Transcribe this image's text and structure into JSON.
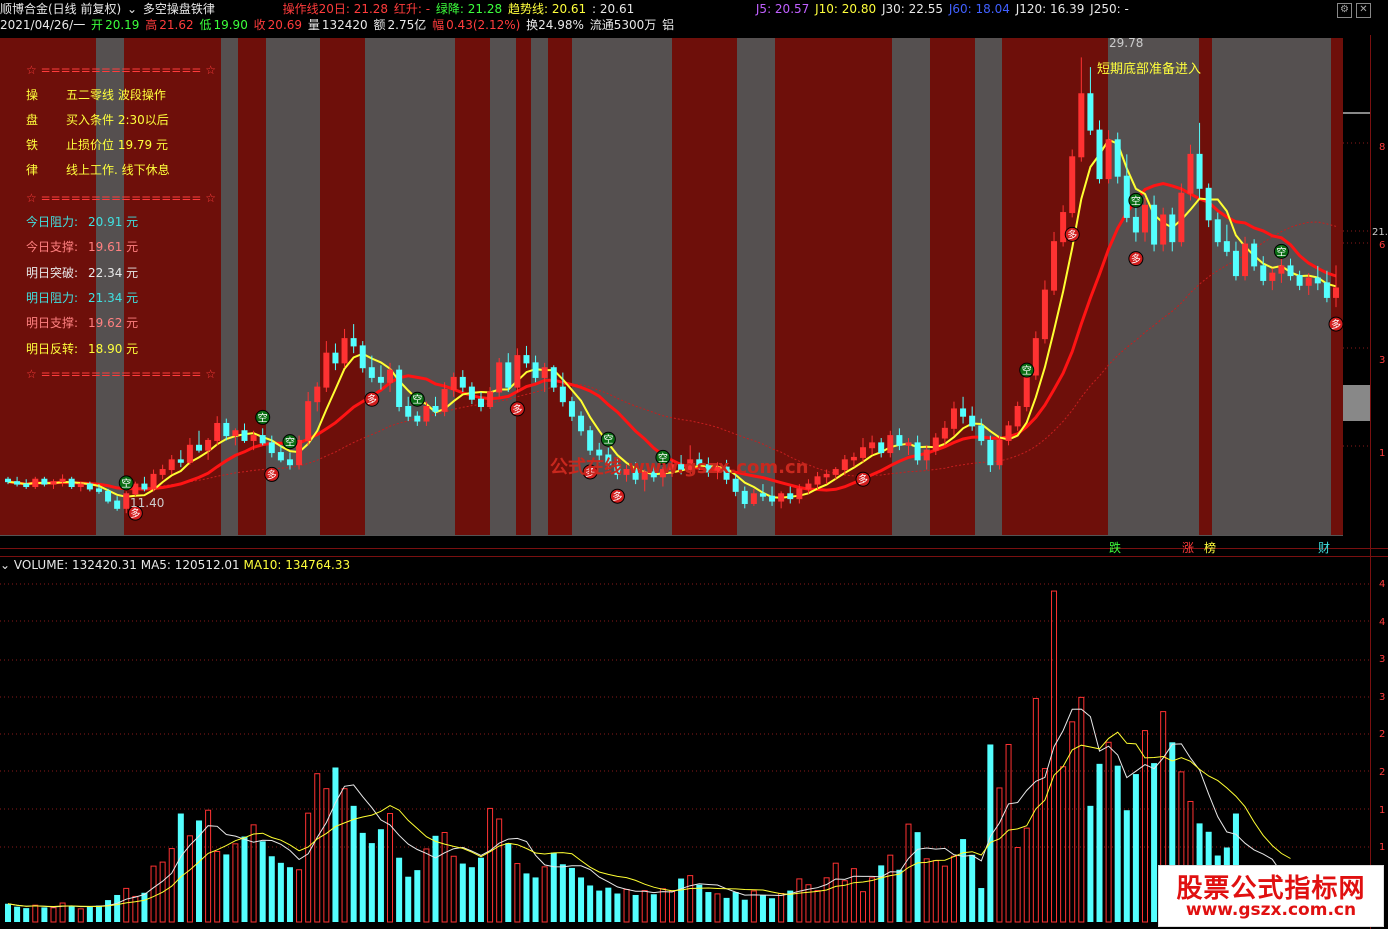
{
  "header": {
    "stock_name": "顺博合金(日线 前复权)",
    "indicator_name": "多空操盘铁律",
    "date": "2021/04/26/一",
    "open_label": "开",
    "open": "20.19",
    "high_label": "高",
    "high": "21.62",
    "low_label": "低",
    "low": "19.90",
    "close_label": "收",
    "close": "20.69",
    "vol_label": "量",
    "vol": "132420",
    "amount_label": "额",
    "amount": "2.75亿",
    "change_label": "幅",
    "change": "0.43(2.12%)",
    "turnover": "换24.98%",
    "float": "流通5300万",
    "sector": "铝",
    "line20": "操作线20日: 21.28",
    "red_up": "红升: -",
    "green_down": "绿降: 21.28",
    "trend": "趋势线: 20.61",
    "trend2": ": 20.61",
    "j5": "J5: 20.57",
    "j10": "J10: 20.80",
    "j30": "J30: 22.55",
    "j60": "J60: 18.04",
    "j120": "J120: 16.39",
    "j250": "J250: -"
  },
  "info_panel": {
    "separator": "☆ ================ ☆",
    "rows": [
      {
        "k": "操",
        "v": "五二零线 波段操作"
      },
      {
        "k": "盘",
        "v": "买入条件  2:30以后"
      },
      {
        "k": "铁",
        "v": "止损价位  19.79 元"
      },
      {
        "k": "律",
        "v": "线上工作. 线下休息"
      }
    ],
    "levels": [
      {
        "label": "今日阻力:",
        "value": "20.91 元",
        "color": "#40e0e0"
      },
      {
        "label": "今日支撑:",
        "value": "19.61 元",
        "color": "#ff8080"
      },
      {
        "label": "明日突破:",
        "value": "22.34 元",
        "color": "#e8e8e8"
      },
      {
        "label": "明日阻力:",
        "value": "21.34 元",
        "color": "#40e0e0"
      },
      {
        "label": "明日支撑:",
        "value": "19.62 元",
        "color": "#ff8080"
      },
      {
        "label": "明日反转:",
        "value": "18.90 元",
        "color": "#ffff3c"
      }
    ]
  },
  "annotations": {
    "peak_label": "29.78",
    "low_label": "11.40",
    "signal_text": "短期底部准备进入",
    "empty_marker": "空",
    "long_marker": "多",
    "bottom_marks": [
      "跌",
      "涨",
      "榜",
      "财"
    ],
    "right_axis_marks": [
      "8",
      "21.",
      "6",
      "3",
      "1"
    ],
    "watermark_mid": "公式在线  www.gszx.com.cn",
    "watermark_corner_1": "股票公式指标网",
    "watermark_corner_2": "www.gszx.com.cn"
  },
  "volume_header": {
    "volume": "VOLUME: 132420.31",
    "ma5": "MA5: 120512.01",
    "ma10": "MA10: 134764.33"
  },
  "vol_axis_marks": [
    "4",
    "4",
    "3",
    "3",
    "2",
    "2",
    "1",
    "1"
  ],
  "colors": {
    "up": "#ff3232",
    "down": "#54ffff",
    "bg_red": "#6e0f0a",
    "bg_gray": "#555050",
    "ma_yellow": "#ffff32",
    "ma_red": "#ff1414"
  },
  "chart_data": {
    "type": "candlestick",
    "ylim": [
      10.5,
      31
    ],
    "candles": [
      [
        12.8,
        12.9,
        12.6,
        12.7
      ],
      [
        12.7,
        12.9,
        12.5,
        12.6
      ],
      [
        12.6,
        12.8,
        12.4,
        12.5
      ],
      [
        12.5,
        12.9,
        12.4,
        12.8
      ],
      [
        12.8,
        12.9,
        12.5,
        12.6
      ],
      [
        12.6,
        12.8,
        12.4,
        12.7
      ],
      [
        12.7,
        13.0,
        12.5,
        12.8
      ],
      [
        12.8,
        12.9,
        12.4,
        12.5
      ],
      [
        12.5,
        12.7,
        12.3,
        12.6
      ],
      [
        12.6,
        12.7,
        12.3,
        12.4
      ],
      [
        12.4,
        12.6,
        12.2,
        12.3
      ],
      [
        12.3,
        12.4,
        11.8,
        11.9
      ],
      [
        11.9,
        12.1,
        11.5,
        11.6
      ],
      [
        11.6,
        12.3,
        11.4,
        12.2
      ],
      [
        12.2,
        12.7,
        12.1,
        12.6
      ],
      [
        12.6,
        12.9,
        12.3,
        12.4
      ],
      [
        12.4,
        13.2,
        12.3,
        13.0
      ],
      [
        13.0,
        13.4,
        12.8,
        13.2
      ],
      [
        13.2,
        13.8,
        13.0,
        13.6
      ],
      [
        13.6,
        14.0,
        13.3,
        13.5
      ],
      [
        13.5,
        14.5,
        13.4,
        14.2
      ],
      [
        14.2,
        14.8,
        13.9,
        14.0
      ],
      [
        14.0,
        14.5,
        13.6,
        14.4
      ],
      [
        14.4,
        15.4,
        14.2,
        15.1
      ],
      [
        15.1,
        15.3,
        14.4,
        14.6
      ],
      [
        14.6,
        14.9,
        14.2,
        14.8
      ],
      [
        14.8,
        15.1,
        14.3,
        14.4
      ],
      [
        14.4,
        14.8,
        14.0,
        14.6
      ],
      [
        14.6,
        14.9,
        14.2,
        14.3
      ],
      [
        14.3,
        14.6,
        13.7,
        13.9
      ],
      [
        13.9,
        14.2,
        13.5,
        13.6
      ],
      [
        13.6,
        13.9,
        13.2,
        13.4
      ],
      [
        13.4,
        14.6,
        13.2,
        14.4
      ],
      [
        14.4,
        16.4,
        14.2,
        16.0
      ],
      [
        16.0,
        16.8,
        15.6,
        16.6
      ],
      [
        16.6,
        18.5,
        16.4,
        18.0
      ],
      [
        18.0,
        18.4,
        17.3,
        17.6
      ],
      [
        17.6,
        19.0,
        17.4,
        18.6
      ],
      [
        18.6,
        19.2,
        18.0,
        18.3
      ],
      [
        18.3,
        18.5,
        17.2,
        17.4
      ],
      [
        17.4,
        17.9,
        16.8,
        17.0
      ],
      [
        17.0,
        17.5,
        16.5,
        16.8
      ],
      [
        16.8,
        17.6,
        16.4,
        17.3
      ],
      [
        17.3,
        17.5,
        15.6,
        15.8
      ],
      [
        15.8,
        16.2,
        15.2,
        15.4
      ],
      [
        15.4,
        15.6,
        15.0,
        15.2
      ],
      [
        15.2,
        16.0,
        15.0,
        15.8
      ],
      [
        15.8,
        16.2,
        15.4,
        15.6
      ],
      [
        15.6,
        16.8,
        15.4,
        16.5
      ],
      [
        16.5,
        17.2,
        16.2,
        17.0
      ],
      [
        17.0,
        17.3,
        16.4,
        16.6
      ],
      [
        16.6,
        16.8,
        15.9,
        16.1
      ],
      [
        16.1,
        16.4,
        15.6,
        15.8
      ],
      [
        15.8,
        16.6,
        15.7,
        16.4
      ],
      [
        16.4,
        17.8,
        16.2,
        17.6
      ],
      [
        17.6,
        18.0,
        16.4,
        16.6
      ],
      [
        16.6,
        18.2,
        16.4,
        17.9
      ],
      [
        17.9,
        18.3,
        17.4,
        17.6
      ],
      [
        17.6,
        17.9,
        16.8,
        17.0
      ],
      [
        17.0,
        17.6,
        16.4,
        17.4
      ],
      [
        17.4,
        17.5,
        16.4,
        16.6
      ],
      [
        16.6,
        17.2,
        15.8,
        16.0
      ],
      [
        16.0,
        16.2,
        15.2,
        15.4
      ],
      [
        15.4,
        15.6,
        14.6,
        14.8
      ],
      [
        14.8,
        15.0,
        13.8,
        14.0
      ],
      [
        14.0,
        14.3,
        13.5,
        13.8
      ],
      [
        13.8,
        14.1,
        13.2,
        13.4
      ],
      [
        13.4,
        13.7,
        12.8,
        13.0
      ],
      [
        13.0,
        13.4,
        12.7,
        13.2
      ],
      [
        13.2,
        13.5,
        12.6,
        12.8
      ],
      [
        12.8,
        13.2,
        12.3,
        13.1
      ],
      [
        13.1,
        13.4,
        12.7,
        12.9
      ],
      [
        12.9,
        13.3,
        12.5,
        13.2
      ],
      [
        13.2,
        13.6,
        12.9,
        13.4
      ],
      [
        13.4,
        13.8,
        13.0,
        13.2
      ],
      [
        13.2,
        14.2,
        13.0,
        13.6
      ],
      [
        13.6,
        13.9,
        13.2,
        13.4
      ],
      [
        13.4,
        13.7,
        12.9,
        13.1
      ],
      [
        13.1,
        13.5,
        12.8,
        13.3
      ],
      [
        13.3,
        13.6,
        12.6,
        12.8
      ],
      [
        12.8,
        13.0,
        12.1,
        12.3
      ],
      [
        12.3,
        12.5,
        11.6,
        11.8
      ],
      [
        11.8,
        12.4,
        11.7,
        12.2
      ],
      [
        12.2,
        12.6,
        11.9,
        12.1
      ],
      [
        12.1,
        12.5,
        11.7,
        11.9
      ],
      [
        11.9,
        12.3,
        11.6,
        12.2
      ],
      [
        12.2,
        12.5,
        11.8,
        12.0
      ],
      [
        12.0,
        12.6,
        11.8,
        12.4
      ],
      [
        12.4,
        12.8,
        12.2,
        12.6
      ],
      [
        12.6,
        13.1,
        12.4,
        12.9
      ],
      [
        12.9,
        13.2,
        12.6,
        13.0
      ],
      [
        13.0,
        13.3,
        12.8,
        13.2
      ],
      [
        13.2,
        13.8,
        13.0,
        13.6
      ],
      [
        13.6,
        13.9,
        13.3,
        13.7
      ],
      [
        13.7,
        14.5,
        13.5,
        14.1
      ],
      [
        14.1,
        14.6,
        13.8,
        14.3
      ],
      [
        14.3,
        14.5,
        13.7,
        13.9
      ],
      [
        13.9,
        14.8,
        13.7,
        14.6
      ],
      [
        14.6,
        14.9,
        14.0,
        14.2
      ],
      [
        14.2,
        14.5,
        13.8,
        14.3
      ],
      [
        14.3,
        14.6,
        13.4,
        13.6
      ],
      [
        13.6,
        14.2,
        13.2,
        14.0
      ],
      [
        14.0,
        14.7,
        13.8,
        14.5
      ],
      [
        14.5,
        15.2,
        14.2,
        14.9
      ],
      [
        14.9,
        16.0,
        14.6,
        15.7
      ],
      [
        15.7,
        16.2,
        15.1,
        15.4
      ],
      [
        15.4,
        15.8,
        14.8,
        15.0
      ],
      [
        15.0,
        15.3,
        14.2,
        14.4
      ],
      [
        14.4,
        14.6,
        13.1,
        13.4
      ],
      [
        13.4,
        14.6,
        13.2,
        14.4
      ],
      [
        14.4,
        15.2,
        14.2,
        15.0
      ],
      [
        15.0,
        16.0,
        14.8,
        15.8
      ],
      [
        15.8,
        17.4,
        15.6,
        17.1
      ],
      [
        17.1,
        18.9,
        16.9,
        18.6
      ],
      [
        18.6,
        21.0,
        18.4,
        20.6
      ],
      [
        20.6,
        23.0,
        20.4,
        22.6
      ],
      [
        22.6,
        24.1,
        22.4,
        23.8
      ],
      [
        23.8,
        26.4,
        23.6,
        26.1
      ],
      [
        26.1,
        30.2,
        25.9,
        28.7
      ],
      [
        28.7,
        29.8,
        27.0,
        27.2
      ],
      [
        27.2,
        27.6,
        25.0,
        25.2
      ],
      [
        25.2,
        27.2,
        25.0,
        26.8
      ],
      [
        26.8,
        27.1,
        25.0,
        25.3
      ],
      [
        25.3,
        26.2,
        23.4,
        23.6
      ],
      [
        23.6,
        24.4,
        22.6,
        23.0
      ],
      [
        23.0,
        24.4,
        22.6,
        24.1
      ],
      [
        24.1,
        24.5,
        22.2,
        22.5
      ],
      [
        22.5,
        24.0,
        22.2,
        23.7
      ],
      [
        23.7,
        24.0,
        22.2,
        22.6
      ],
      [
        22.6,
        25.0,
        22.4,
        24.6
      ],
      [
        24.6,
        26.6,
        24.3,
        26.2
      ],
      [
        26.2,
        27.5,
        24.4,
        24.8
      ],
      [
        24.8,
        25.0,
        23.2,
        23.5
      ],
      [
        23.5,
        23.8,
        22.4,
        22.6
      ],
      [
        22.6,
        23.3,
        22.0,
        22.2
      ],
      [
        22.2,
        22.6,
        21.0,
        21.2
      ],
      [
        21.2,
        22.8,
        21.0,
        22.5
      ],
      [
        22.5,
        22.7,
        21.4,
        21.6
      ],
      [
        21.6,
        22.0,
        20.8,
        21.0
      ],
      [
        21.0,
        21.5,
        20.6,
        21.3
      ],
      [
        21.3,
        21.9,
        20.9,
        21.6
      ],
      [
        21.6,
        21.9,
        21.0,
        21.2
      ],
      [
        21.2,
        21.4,
        20.6,
        20.8
      ],
      [
        20.8,
        21.3,
        20.4,
        21.1
      ],
      [
        21.1,
        21.6,
        20.6,
        20.9
      ],
      [
        20.9,
        21.4,
        20.1,
        20.3
      ],
      [
        20.3,
        21.62,
        19.9,
        20.69
      ]
    ],
    "volumes": [
      5,
      4.2,
      3.8,
      4.6,
      4.0,
      3.9,
      5.2,
      4.4,
      3.6,
      4.1,
      4.5,
      6.0,
      7.4,
      9.2,
      7.0,
      8.0,
      15.3,
      16.4,
      20.1,
      29.7,
      23.6,
      27.8,
      30.6,
      19.3,
      18.5,
      21.4,
      23.4,
      26.6,
      22.1,
      18.0,
      16.2,
      15.0,
      14.3,
      29.8,
      40.6,
      36.5,
      42.3,
      36.5,
      31.8,
      24.4,
      21.6,
      25.4,
      29.7,
      17.6,
      12.4,
      14.2,
      20.0,
      23.6,
      24.5,
      18.0,
      16.0,
      15.0,
      17.6,
      31.1,
      28.2,
      21.6,
      16.0,
      13.3,
      12.2,
      15.1,
      19.0,
      15.8,
      14.8,
      12.2,
      10.0,
      8.6,
      9.4,
      7.8,
      8.9,
      7.4,
      8.6,
      7.6,
      9.1,
      8.4,
      11.9,
      12.7,
      10.2,
      8.2,
      7.7,
      6.6,
      8.2,
      6.1,
      8.5,
      7.4,
      6.5,
      7.8,
      8.6,
      11.8,
      10.2,
      8.6,
      12.1,
      16.1,
      11.3,
      14.6,
      8.3,
      12.1,
      15.5,
      18.3,
      14.3,
      26.8,
      24.6,
      17.3,
      16.8,
      15.3,
      18.0,
      22.7,
      18.4,
      9.3,
      48.6,
      36.7,
      48.6,
      20.4,
      25.7,
      61.2,
      42.0,
      90.6,
      42.5,
      54.8,
      61.5,
      31.8,
      43.3,
      49.2,
      42.8,
      30.6,
      40.5,
      52.4,
      43.5,
      57.6,
      49.2,
      41.1,
      33.0,
      27.0,
      24.7,
      18.2,
      20.4,
      29.7,
      14.8,
      15.6,
      12.5,
      13.2,
      11.6,
      13.2
    ]
  }
}
